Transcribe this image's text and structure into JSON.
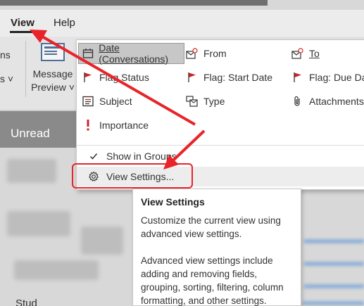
{
  "menubar": {
    "view_tab": "View",
    "help_tab": "Help"
  },
  "ribbon": {
    "fragment_top": "ns",
    "fragment_bottom": "s ˅",
    "message_preview_line1": "Message",
    "message_preview_line2": "Preview ˅"
  },
  "mailbox": {
    "unread_label": "Unread",
    "bottom_fragment": "Stud"
  },
  "arrange_by": {
    "date_conversations": "Date (Conversations)",
    "from": "From",
    "to": "To",
    "flag_status": "Flag Status",
    "flag_start_date": "Flag: Start Date",
    "flag_due_date": "Flag: Due Dat",
    "subject": "Subject",
    "type": "Type",
    "attachments": "Attachments",
    "importance": "Importance"
  },
  "commands": {
    "show_in_groups": "Show in Groups",
    "view_settings": "View Settings..."
  },
  "tooltip": {
    "title": "View Settings",
    "line1": "Customize the current view using advanced view settings.",
    "line2": "Advanced view settings include adding and removing fields, grouping, sorting, filtering, column formatting, and other settings."
  },
  "colors": {
    "annotation_red": "#e8242a",
    "flag_red": "#c8262b",
    "icon_blue": "#4f6f98",
    "menu_selected": "#c7c7c7"
  }
}
